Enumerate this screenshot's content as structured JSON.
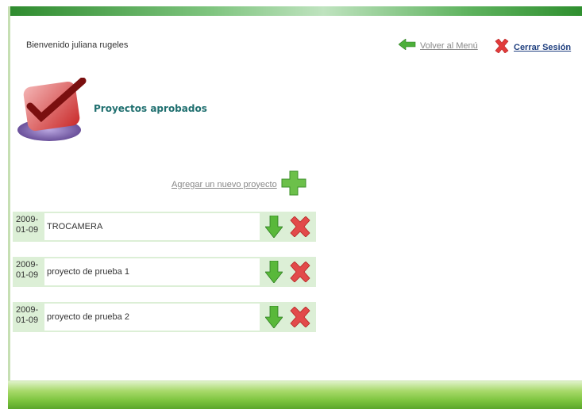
{
  "header": {
    "welcome_text": "Bienvenido juliana rugeles",
    "back_label": "Volver al Menú",
    "logout_label": "Cerrar Sesión"
  },
  "section": {
    "title": "Proyectos aprobados",
    "add_label": "Agregar un nuevo proyecto"
  },
  "projects": [
    {
      "date_line1": "2009-",
      "date_line2": "01-09",
      "name": "TROCAMERA"
    },
    {
      "date_line1": "2009-",
      "date_line2": "01-09",
      "name": "proyecto de prueba 1"
    },
    {
      "date_line1": "2009-",
      "date_line2": "01-09",
      "name": "proyecto de prueba 2"
    }
  ],
  "colors": {
    "accent_green": "#4caf3a",
    "delete_red": "#e23b3b",
    "title_teal": "#1f6f6f",
    "row_bg": "#dcefd6"
  },
  "icons": {
    "back": "arrow-left-icon",
    "logout": "x-icon",
    "add": "plus-icon",
    "download": "arrow-down-icon",
    "delete": "x-icon"
  }
}
